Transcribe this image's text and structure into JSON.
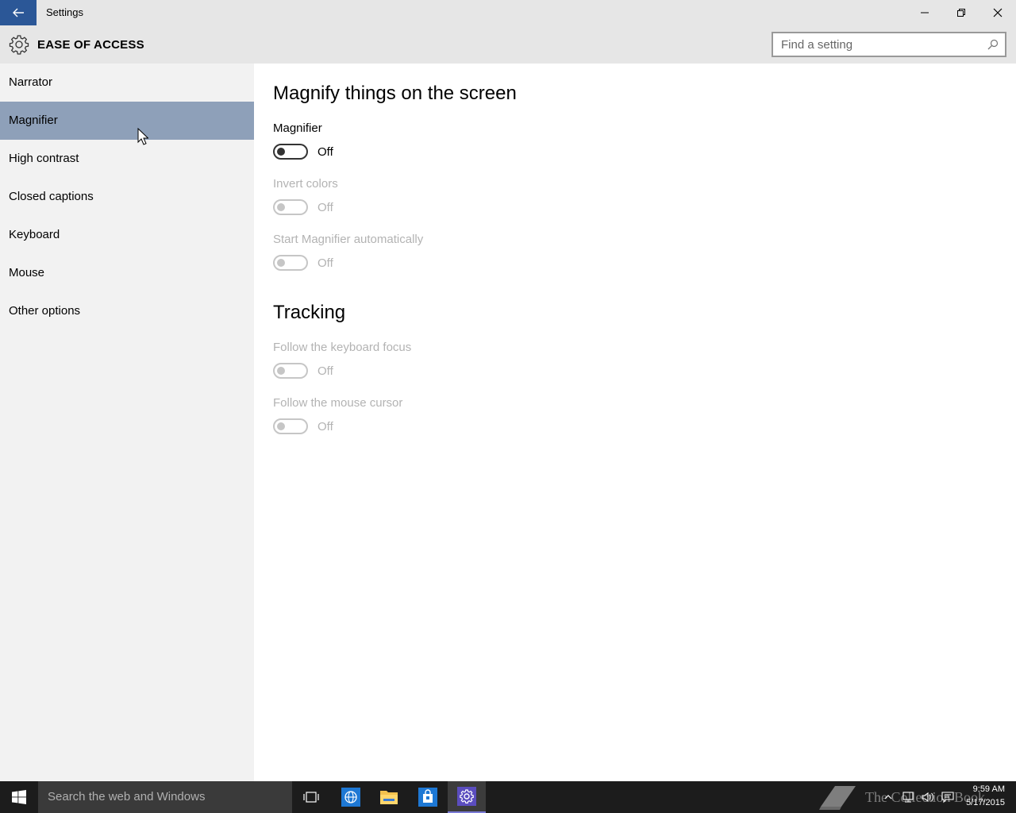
{
  "window": {
    "title": "Settings",
    "back_icon": "back-arrow-icon",
    "controls": [
      "minimize-icon",
      "restore-icon",
      "close-icon"
    ]
  },
  "header": {
    "icon": "gear-icon",
    "section_title": "EASE OF ACCESS",
    "search_placeholder": "Find a setting"
  },
  "sidebar": {
    "items": [
      {
        "label": "Narrator",
        "selected": false
      },
      {
        "label": "Magnifier",
        "selected": true
      },
      {
        "label": "High contrast",
        "selected": false
      },
      {
        "label": "Closed captions",
        "selected": false
      },
      {
        "label": "Keyboard",
        "selected": false
      },
      {
        "label": "Mouse",
        "selected": false
      },
      {
        "label": "Other options",
        "selected": false
      }
    ],
    "selected_color": "#8ea0b9"
  },
  "main": {
    "heading": "Magnify things on the screen",
    "settings": [
      {
        "label": "Magnifier",
        "state": "Off",
        "enabled": true
      },
      {
        "label": "Invert colors",
        "state": "Off",
        "enabled": false
      },
      {
        "label": "Start Magnifier automatically",
        "state": "Off",
        "enabled": false
      }
    ],
    "tracking_heading": "Tracking",
    "tracking": [
      {
        "label": "Follow the keyboard focus",
        "state": "Off",
        "enabled": false
      },
      {
        "label": "Follow the mouse cursor",
        "state": "Off",
        "enabled": false
      }
    ]
  },
  "taskbar": {
    "search_placeholder": "Search the web and Windows",
    "apps": [
      "task-view-icon",
      "internet-explorer-icon",
      "file-explorer-icon",
      "store-icon",
      "settings-icon"
    ],
    "active_app": "settings-icon",
    "watermark": "The Collection Book",
    "time": "9:59 AM",
    "date": "5/17/2015"
  },
  "colors": {
    "accent": "#2b5797",
    "taskbar": "#1c1c1c"
  }
}
